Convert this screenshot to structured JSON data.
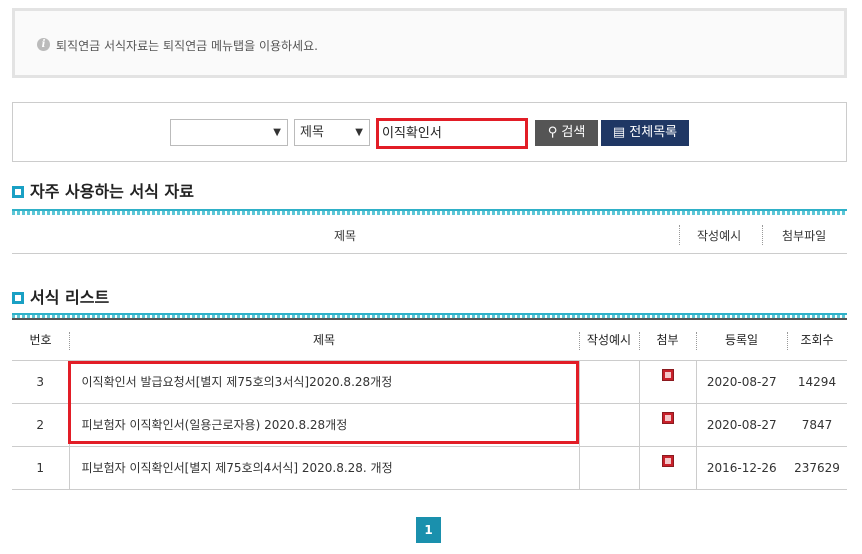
{
  "notice": {
    "text": "퇴직연금 서식자료는 퇴직연금 메뉴탭을 이용하세요.",
    "icon": "info-icon"
  },
  "search": {
    "category_value": "",
    "field_value": "제목",
    "query": "이직확인서",
    "search_label": "검색",
    "list_all_label": "전체목록"
  },
  "favorites": {
    "title": "자주 사용하는 서식 자료",
    "columns": {
      "title": "제목",
      "example": "작성예시",
      "attachment": "첨부파일"
    }
  },
  "forms": {
    "title": "서식 리스트",
    "columns": {
      "no": "번호",
      "title": "제목",
      "example": "작성예시",
      "attach": "첨부",
      "date": "등록일",
      "views": "조회수"
    },
    "rows": [
      {
        "no": "3",
        "title": "이직확인서 발급요청서[별지 제75호의3서식]2020.8.28개정",
        "date": "2020-08-27",
        "views": "14294"
      },
      {
        "no": "2",
        "title": "피보험자 이직확인서(일용근로자용) 2020.8.28개정",
        "date": "2020-08-27",
        "views": "7847"
      },
      {
        "no": "1",
        "title": "피보험자 이직확인서[별지 제75호의4서식] 2020.8.28. 개정",
        "date": "2016-12-26",
        "views": "237629"
      }
    ]
  },
  "pagination": {
    "current": "1"
  },
  "colors": {
    "accent": "#1aa0c4",
    "highlight": "#e21d26",
    "navy": "#1f3764"
  }
}
